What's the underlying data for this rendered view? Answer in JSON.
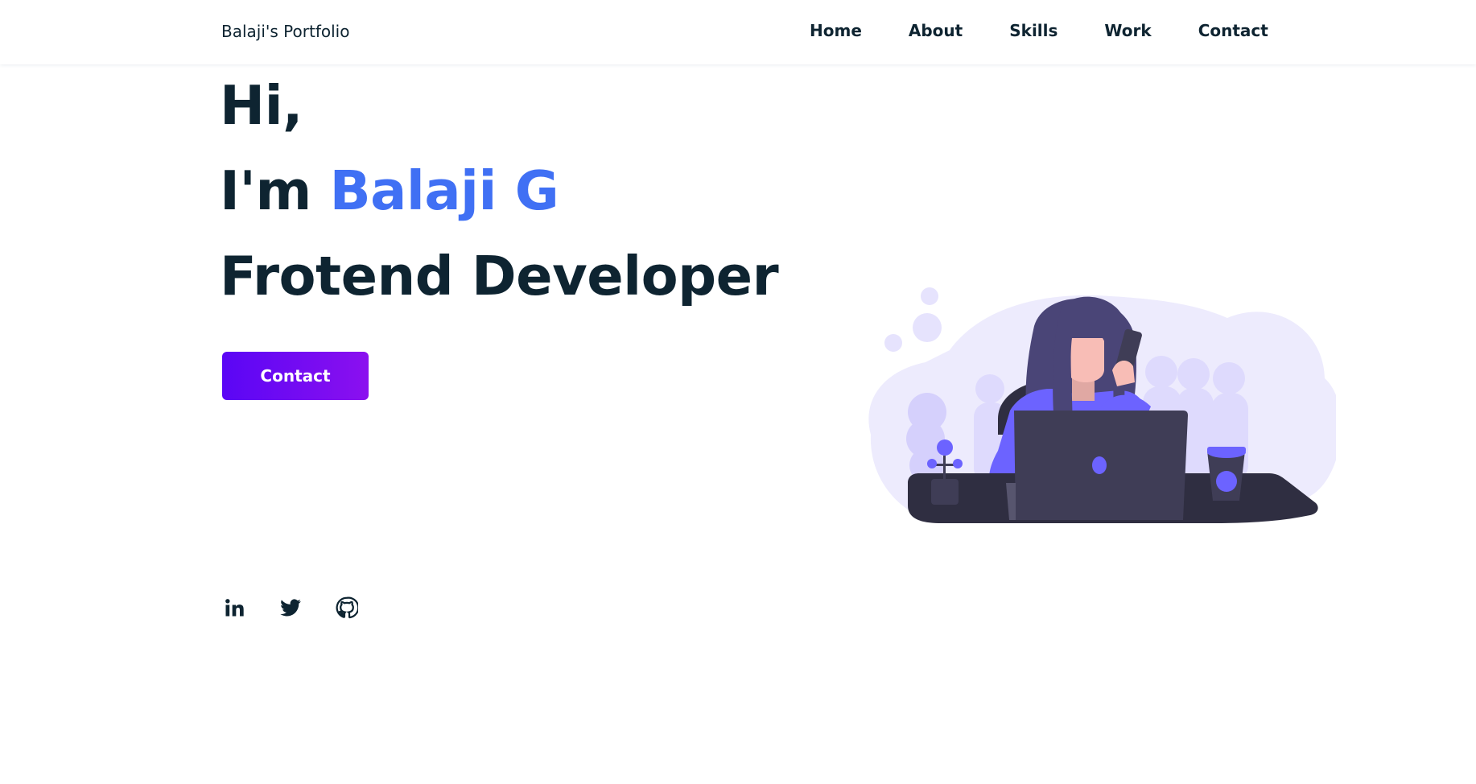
{
  "header": {
    "logo": "Balaji's Portfolio",
    "nav": [
      "Home",
      "About",
      "Skills",
      "Work",
      "Contact"
    ]
  },
  "hero": {
    "line1": "Hi,",
    "line2_prefix": "I'm ",
    "name": "Balaji G",
    "line3": "Frotend Developer",
    "button": "Contact"
  },
  "social": {
    "icons": [
      "linkedin-icon",
      "twitter-icon",
      "github-icon"
    ]
  },
  "colors": {
    "text": "#0e2431",
    "accent": "#4070f4",
    "button_start": "#5a06f5",
    "button_end": "#8b10ef",
    "illustration_purple": "#6c63ff",
    "illustration_dark": "#3f3d56"
  }
}
